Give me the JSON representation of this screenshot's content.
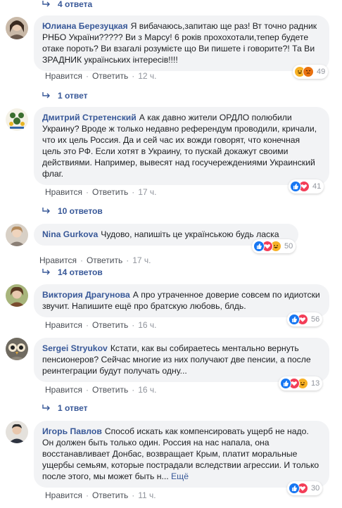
{
  "top_replies": {
    "label": "4 ответа"
  },
  "actions": {
    "like": "Нравится",
    "reply": "Ответить",
    "sep": "·"
  },
  "comments": [
    {
      "name": "Юлиана Березуцкая",
      "text": "Я вибачаюсь,запитаю ще раз! Вт точно радник РНБО України????? Ви з Марсу! 6 років прохохотали,тепер будете отаке пороть? Ви взагалі розумієте що Ви пишете і говорите?! Та Ви ЗРАДНИК українських інтересів!!!!",
      "time": "12 ч.",
      "reactions": [
        "haha",
        "angry"
      ],
      "count": "49",
      "replies": "1 ответ"
    },
    {
      "name": "Дмитрий Стретенский",
      "text": "А как давно жители ОРДЛО полюбили Украину? Вроде ж только недавно референдум проводили, кричали, что их цель Россия. Да и сей час их вожди говорят, что конечная цель это РФ. Если хотят в Украину, то пускай докажут своими действиями. Например, вывесят над госучереждениями Украинский флаг.",
      "time": "17 ч.",
      "reactions": [
        "like",
        "love"
      ],
      "count": "41",
      "replies": "10 ответов"
    },
    {
      "name": "Nina Gurkova",
      "text": "Чудово, напишіть це українською будь ласка",
      "time": "17 ч.",
      "reactions": [
        "like",
        "love",
        "haha"
      ],
      "count": "50",
      "replies": "14 ответов"
    },
    {
      "name": "Виктория Драгунова",
      "text": "А про утраченное доверие совсем по идиотски звучит. Напишите ещё про братскую любовь, блдь.",
      "time": "16 ч.",
      "reactions": [
        "like",
        "love"
      ],
      "count": "56",
      "replies": ""
    },
    {
      "name": "Sergei Stryukov",
      "text": "Кстати, как вы собираетесь ментально вернуть пенсионеров? Сейчас многие из них получают две пенсии, а после реинтеграции будут получать одну...",
      "time": "16 ч.",
      "reactions": [
        "like",
        "love",
        "haha"
      ],
      "count": "13",
      "replies": "1 ответ"
    },
    {
      "name": "Игорь Павлов",
      "text": "Способ искать как компенсировать ущерб не надо. Он должен быть только один. Россия на нас напала, она восстанавливает Донбас, возвращает Крым, платит моральные ущербы семьям, которые пострадали вследствии агрессии. И только после этого, мы может быть н...",
      "more": "Ещё",
      "time": "11 ч.",
      "reactions": [
        "like",
        "love"
      ],
      "count": "30",
      "replies": ""
    }
  ]
}
